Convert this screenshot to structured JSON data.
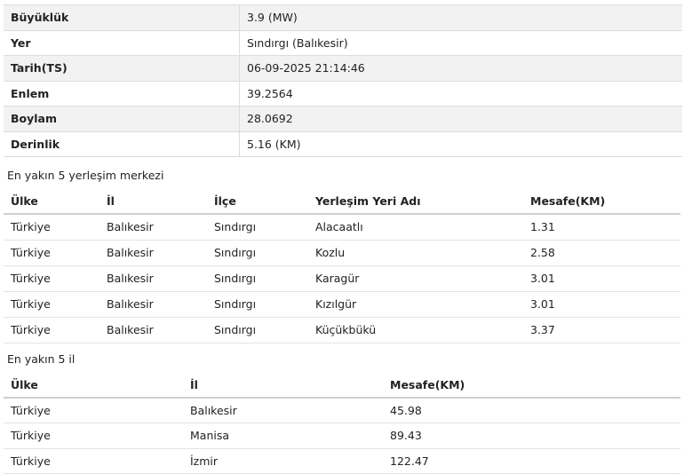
{
  "earthquake_info": [
    {
      "label": "Büyüklük",
      "value": "3.9 (MW)"
    },
    {
      "label": "Yer",
      "value": "Sındırgı (Balıkesir)"
    },
    {
      "label": "Tarih(TS)",
      "value": "06-09-2025 21:14:46"
    },
    {
      "label": "Enlem",
      "value": "39.2564"
    },
    {
      "label": "Boylam",
      "value": "28.0692"
    },
    {
      "label": "Derinlik",
      "value": "5.16 (KM)"
    }
  ],
  "settlements": {
    "title": "En yakın 5 yerleşim merkezi",
    "columns": [
      "Ülke",
      "İl",
      "İlçe",
      "Yerleşim Yeri Adı",
      "Mesafe(KM)"
    ],
    "rows": [
      [
        "Türkiye",
        "Balıkesir",
        "Sındırgı",
        "Alacaatlı",
        "1.31"
      ],
      [
        "Türkiye",
        "Balıkesir",
        "Sındırgı",
        "Kozlu",
        "2.58"
      ],
      [
        "Türkiye",
        "Balıkesir",
        "Sındırgı",
        "Karagür",
        "3.01"
      ],
      [
        "Türkiye",
        "Balıkesir",
        "Sındırgı",
        "Kızılgür",
        "3.01"
      ],
      [
        "Türkiye",
        "Balıkesir",
        "Sındırgı",
        "Küçükbükü",
        "3.37"
      ]
    ]
  },
  "provinces": {
    "title": "En yakın 5 il",
    "columns": [
      "Ülke",
      "İl",
      "Mesafe(KM)"
    ],
    "rows": [
      [
        "Türkiye",
        "Balıkesir",
        "45.98"
      ],
      [
        "Türkiye",
        "Manisa",
        "89.43"
      ],
      [
        "Türkiye",
        "İzmir",
        "122.47"
      ]
    ]
  }
}
